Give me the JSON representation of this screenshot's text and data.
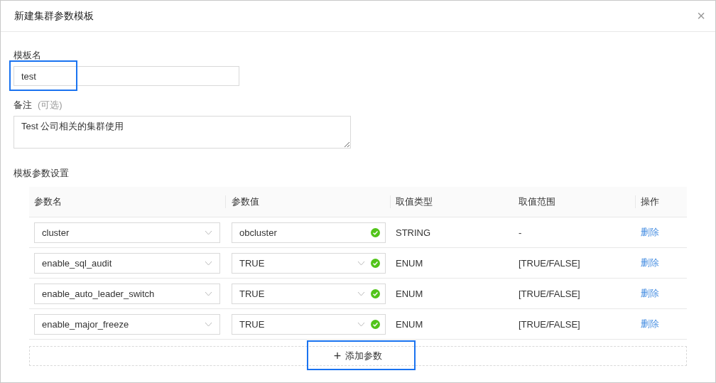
{
  "dialog": {
    "title": "新建集群参数模板",
    "close": "×"
  },
  "template_name": {
    "label": "模板名",
    "value": "test",
    "highlighted": true
  },
  "remark": {
    "label": "备注",
    "hint": "(可选)",
    "value": "Test 公司相关的集群使用"
  },
  "params": {
    "label": "模板参数设置",
    "columns": [
      "参数名",
      "参数值",
      "取值类型",
      "取值范围",
      "操作"
    ],
    "rows": [
      {
        "name": "cluster",
        "value": {
          "text": "obcluster",
          "kind": "input"
        },
        "valid": true,
        "type": "STRING",
        "range": "-",
        "action": "删除"
      },
      {
        "name": "enable_sql_audit",
        "value": {
          "text": "TRUE",
          "kind": "select"
        },
        "valid": true,
        "type": "ENUM",
        "range": "[TRUE/FALSE]",
        "action": "删除"
      },
      {
        "name": "enable_auto_leader_switch",
        "value": {
          "text": "TRUE",
          "kind": "select"
        },
        "valid": true,
        "type": "ENUM",
        "range": "[TRUE/FALSE]",
        "action": "删除"
      },
      {
        "name": "enable_major_freeze",
        "value": {
          "text": "TRUE",
          "kind": "select"
        },
        "valid": true,
        "type": "ENUM",
        "range": "[TRUE/FALSE]",
        "action": "删除"
      }
    ],
    "add_button": {
      "icon": "+",
      "label": "添加参数",
      "highlighted": true
    }
  }
}
